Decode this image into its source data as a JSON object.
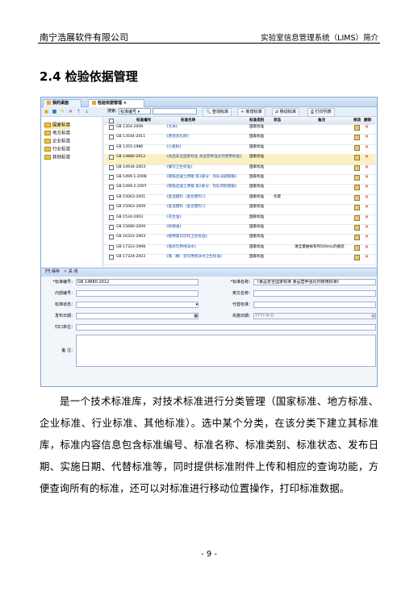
{
  "header": {
    "company": "南宁浩展软件有限公司",
    "doc_title": "实验室信息管理系统（LIMS）简介"
  },
  "section_title": "2.4 检验依据管理",
  "screenshot": {
    "tabs": [
      "我的桌面",
      "检验依据管理"
    ],
    "toolbar": {
      "search_label": "搜索:",
      "search_field": "标准编号",
      "buttons": [
        "查询标准",
        "新增标准",
        "移动标准",
        "打印列表"
      ]
    },
    "tree": [
      "国家标准",
      "地方标准",
      "企业标准",
      "行业标准",
      "其他标准"
    ],
    "grid": {
      "columns": [
        "标准编号",
        "标准名称",
        "标准类别",
        "状态",
        "备注",
        "修改",
        "删除"
      ],
      "rows": [
        {
          "code": "GB 1354-2009",
          "name": "《大米》",
          "type": "国家标准",
          "status": "",
          "remark": ""
        },
        {
          "code": "GB 13544-2011",
          "name": "《原烧多孔砖》",
          "type": "国家标准",
          "status": "",
          "remark": ""
        },
        {
          "code": "GB 1355-1986",
          "name": "《小麦粉》",
          "type": "国家标准",
          "status": "",
          "remark": ""
        },
        {
          "code": "GB 14880-2012",
          "name": "《食品安全国家标准 食品营养强化剂使用标准》",
          "type": "国家标准",
          "status": "",
          "remark": ""
        },
        {
          "code": "GB 14934-2003",
          "name": "《餐饮卫生标准》",
          "type": "国家标准",
          "status": "",
          "remark": ""
        },
        {
          "code": "GB 1499.1-2008",
          "name": "《钢筋混凝土用钢 第1部分：热轧光圆钢筋》",
          "type": "国家标准",
          "status": "",
          "remark": ""
        },
        {
          "code": "GB 1499.2-2007",
          "name": "《钢筋混凝土用钢 第2部分：热轧带肋钢筋》",
          "type": "国家标准",
          "status": "",
          "remark": ""
        },
        {
          "code": "GB 15063-2001",
          "name": "《复混肥料（复合肥料）》",
          "type": "国家标准",
          "status": "作废",
          "remark": ""
        },
        {
          "code": "GB 15063-2009",
          "name": "《复混肥料（复合肥料）》",
          "type": "国家标准",
          "status": "",
          "remark": ""
        },
        {
          "code": "GB 1534-2003",
          "name": "《花生油》",
          "type": "国家标准",
          "status": "",
          "remark": ""
        },
        {
          "code": "GB 15680-2009",
          "name": "《棕榈油》",
          "type": "国家标准",
          "status": "",
          "remark": ""
        },
        {
          "code": "GB 16322-2003",
          "name": "《植物蛋白饮料卫生标准》",
          "type": "国家标准",
          "status": "",
          "remark": ""
        },
        {
          "code": "GB 17323-1998",
          "name": "《瓶装饮用纯净水》",
          "type": "国家标准",
          "status": "",
          "remark": "请全量抽样系列500mL的瓶装"
        },
        {
          "code": "GB 17324-2003",
          "name": "《瓶（桶）装饮用纯净水卫生标准》",
          "type": "国家标准",
          "status": "",
          "remark": ""
        }
      ]
    },
    "form_bar": {
      "save": "保存",
      "close": "关 闭"
    },
    "form": {
      "code_label": "*标准编号：",
      "code_value": "GB 14880-2012",
      "name_label": "*标准名称：",
      "name_value": "《食品安全国家标准 食品营养强化剂使用标准》",
      "inner_label": "内部编号：",
      "en_label": "英文名称：",
      "status_label": "标准状态：",
      "replace_label": "代替标准：",
      "publish_label": "发布日期：",
      "impl_label": "实施日期：",
      "impl_value": "YYYY-M-D",
      "attach_label": "归口单位：",
      "remark_label": "备 注："
    }
  },
  "paragraph": "是一个技术标准库，对技术标准进行分类管理（国家标准、地方标准、企业标准、行业标准、其他标准）。选中某个分类，在该分类下建立其标准库，标准内容信息包含标准编号、标准名称、标准类别、标准状态、发布日期、实施日期、代替标准等，同时提供标准附件上传和相应的查询功能，方便查询所有的标准，还可以对标准进行移动位置操作，打印标准数据。",
  "page_number": "- 9 -"
}
